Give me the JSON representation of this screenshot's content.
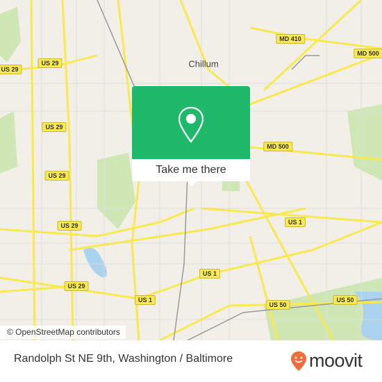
{
  "map": {
    "places": [
      {
        "label": "Chillum"
      }
    ],
    "shields": [
      {
        "label": "US 29"
      },
      {
        "label": "US 29"
      },
      {
        "label": "US 29"
      },
      {
        "label": "US 29"
      },
      {
        "label": "US 29"
      },
      {
        "label": "US 29"
      },
      {
        "label": "MD 410"
      },
      {
        "label": "MD 500"
      },
      {
        "label": "MD 500"
      },
      {
        "label": "US 1"
      },
      {
        "label": "US 1"
      },
      {
        "label": "US 1"
      },
      {
        "label": "US 50"
      },
      {
        "label": "US 50"
      }
    ],
    "attribution": "© OpenStreetMap contributors",
    "colors": {
      "background": "#f2efe9",
      "road": "#f7e94f",
      "park": "#cfe7b5",
      "water": "#a9d3ee",
      "popup": "#1fb96b",
      "brand": "#f26b3a"
    }
  },
  "popup": {
    "icon": "location-pin-icon",
    "button_label": "Take me there"
  },
  "footer": {
    "title": "Randolph St NE 9th, Washington / Baltimore",
    "logo_text": "moovit"
  }
}
